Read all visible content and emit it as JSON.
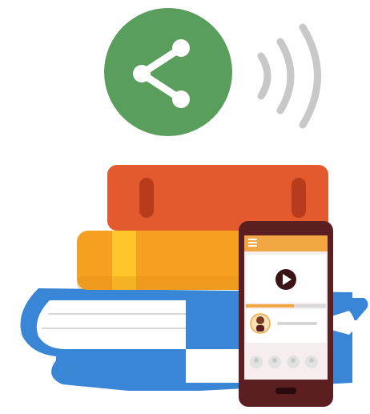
{
  "illustration": {
    "share_badge": {
      "icon": "share-icon",
      "color": "#5a9e5e"
    },
    "broadcast_waves": {
      "icon": "sound-wave-icon",
      "color": "#c8c8c8",
      "count": 3
    },
    "books": {
      "top_color": "#e35a2e",
      "middle_color": "#f5a021",
      "bottom_color": "#3a86d6",
      "pages_color": "#ffffff"
    },
    "phone": {
      "frame_color": "#5c1f21",
      "header_color": "#f2a742",
      "menu_icon": "hamburger-menu-icon",
      "play_icon": "play-icon",
      "progress": 0.6,
      "progress_color": "#f2a742",
      "avatar_icon": "person-avatar-icon",
      "small_avatars": 4
    }
  }
}
